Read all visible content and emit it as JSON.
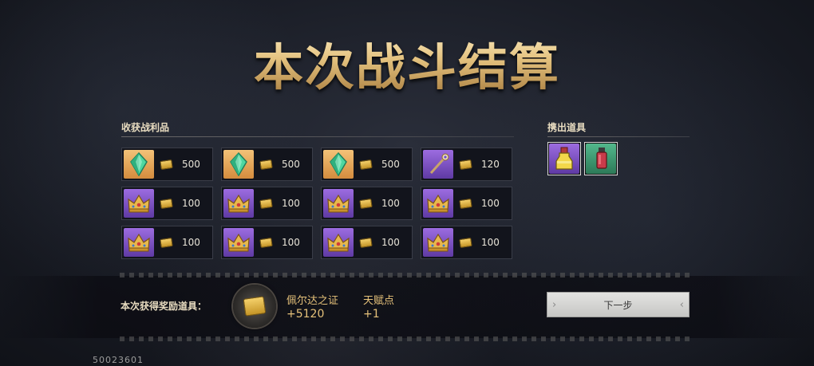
{
  "title": "本次战斗结算",
  "loot": {
    "label": "收获战利品",
    "items": [
      {
        "icon": "crystal-icon",
        "bg": "gold",
        "amount": "500"
      },
      {
        "icon": "crystal-icon",
        "bg": "gold",
        "amount": "500"
      },
      {
        "icon": "crystal-icon",
        "bg": "gold",
        "amount": "500"
      },
      {
        "icon": "staff-icon",
        "bg": "purple",
        "amount": "120"
      },
      {
        "icon": "crown-icon",
        "bg": "purple",
        "amount": "100"
      },
      {
        "icon": "crown-icon",
        "bg": "purple",
        "amount": "100"
      },
      {
        "icon": "crown-icon",
        "bg": "purple",
        "amount": "100"
      },
      {
        "icon": "crown-icon",
        "bg": "purple",
        "amount": "100"
      },
      {
        "icon": "crown-icon",
        "bg": "purple",
        "amount": "100"
      },
      {
        "icon": "crown-icon",
        "bg": "purple",
        "amount": "100"
      },
      {
        "icon": "crown-icon",
        "bg": "purple",
        "amount": "100"
      },
      {
        "icon": "crown-icon",
        "bg": "purple",
        "amount": "100"
      }
    ]
  },
  "dropped": {
    "label": "携出道具",
    "items": [
      {
        "icon": "potion-icon",
        "bg": "purple"
      },
      {
        "icon": "red-vial-icon",
        "bg": "green"
      }
    ]
  },
  "rewards": {
    "label": "本次获得奖励道具：",
    "items": [
      {
        "name": "佩尔达之证",
        "value": "+5120"
      },
      {
        "name": "天赋点",
        "value": "+1"
      }
    ]
  },
  "next_button": "下一步",
  "footer_id": "50023601",
  "colors": {
    "accent_gold": "#e6c27a",
    "title_gold": "#d8b878"
  }
}
